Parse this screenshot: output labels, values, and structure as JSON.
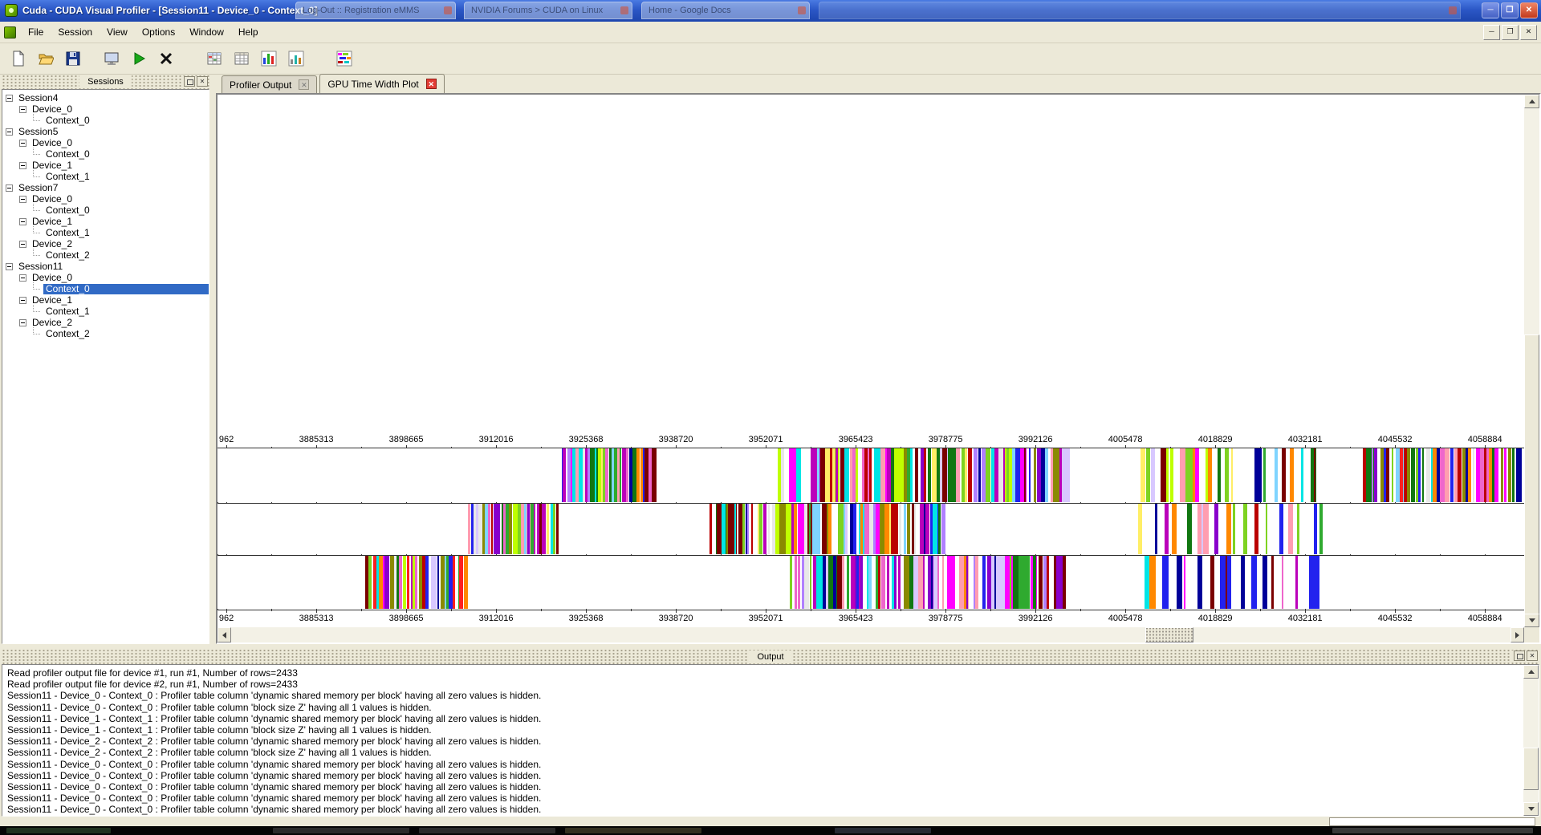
{
  "window": {
    "title": "Cuda - CUDA Visual Profiler - [Session11 - Device_0 - Context_0]",
    "controls": {
      "minimize": "─",
      "maximize": "❐",
      "close": "✕"
    },
    "ghost_windows": [
      "Log-Out :: Registration eMMS",
      "NVIDIA Forums > CUDA on Linux",
      "Home - Google Docs",
      ""
    ]
  },
  "menu": {
    "items": [
      "File",
      "Session",
      "View",
      "Options",
      "Window",
      "Help"
    ]
  },
  "mdi_controls": {
    "minimize": "─",
    "restore": "❐",
    "close": "✕"
  },
  "toolbar": {
    "icons": [
      "new-session-icon",
      "open-session-icon",
      "save-session-icon",
      "profiler-output-icon",
      "start-profiling-icon",
      "stop-icon",
      "profiler-table-icon",
      "summary-table-icon",
      "gpu-time-height-plot-icon",
      "gpu-time-summary-plot-icon",
      "gpu-time-width-plot-icon"
    ]
  },
  "sessions_panel": {
    "title": "Sessions",
    "tree": [
      {
        "label": "Session4",
        "level": 0
      },
      {
        "label": "Device_0",
        "level": 1
      },
      {
        "label": "Context_0",
        "level": 2,
        "leaf": true
      },
      {
        "label": "Session5",
        "level": 0
      },
      {
        "label": "Device_0",
        "level": 1
      },
      {
        "label": "Context_0",
        "level": 2,
        "leaf": true
      },
      {
        "label": "Device_1",
        "level": 1
      },
      {
        "label": "Context_1",
        "level": 2,
        "leaf": true
      },
      {
        "label": "Session7",
        "level": 0
      },
      {
        "label": "Device_0",
        "level": 1
      },
      {
        "label": "Context_0",
        "level": 2,
        "leaf": true
      },
      {
        "label": "Device_1",
        "level": 1
      },
      {
        "label": "Context_1",
        "level": 2,
        "leaf": true
      },
      {
        "label": "Device_2",
        "level": 1
      },
      {
        "label": "Context_2",
        "level": 2,
        "leaf": true
      },
      {
        "label": "Session11",
        "level": 0
      },
      {
        "label": "Device_0",
        "level": 1
      },
      {
        "label": "Context_0",
        "level": 2,
        "leaf": true,
        "selected": true
      },
      {
        "label": "Device_1",
        "level": 1
      },
      {
        "label": "Context_1",
        "level": 2,
        "leaf": true
      },
      {
        "label": "Device_2",
        "level": 1
      },
      {
        "label": "Context_2",
        "level": 2,
        "leaf": true
      }
    ]
  },
  "tabs": [
    {
      "label": "Profiler Output",
      "active": false
    },
    {
      "label": "GPU Time Width Plot",
      "active": true
    }
  ],
  "chart_data": {
    "type": "timeline",
    "title": "GPU Time Width Plot",
    "x_tick_labels": [
      "962",
      "3885313",
      "3898665",
      "3912016",
      "3925368",
      "3938720",
      "3952071",
      "3965423",
      "3978775",
      "3992126",
      "4005478",
      "4018829",
      "4032181",
      "4045532",
      "4058884"
    ],
    "x_axis": {
      "first_tick_fraction": 0.0068,
      "tick_step_fraction": 0.0688,
      "note": "GPU time axis; identical tick labels drawn above and below the lane stack"
    },
    "lanes": [
      {
        "name": "context-row-1",
        "clusters": [
          {
            "start": 0.262,
            "end": 0.331,
            "count": 30
          },
          {
            "start": 0.425,
            "end": 0.445,
            "count": 4
          },
          {
            "start": 0.452,
            "end": 0.56,
            "count": 36
          },
          {
            "start": 0.565,
            "end": 0.648,
            "count": 26
          },
          {
            "start": 0.703,
            "end": 0.778,
            "count": 15
          },
          {
            "start": 0.79,
            "end": 0.845,
            "count": 8
          },
          {
            "start": 0.876,
            "end": 0.995,
            "count": 40
          }
        ]
      },
      {
        "name": "context-row-2",
        "clusters": [
          {
            "start": 0.19,
            "end": 0.26,
            "count": 30
          },
          {
            "start": 0.376,
            "end": 0.47,
            "count": 32
          },
          {
            "start": 0.474,
            "end": 0.556,
            "count": 28
          },
          {
            "start": 0.703,
            "end": 0.85,
            "count": 18
          }
        ]
      },
      {
        "name": "context-row-3",
        "clusters": [
          {
            "start": 0.112,
            "end": 0.19,
            "count": 30
          },
          {
            "start": 0.436,
            "end": 0.56,
            "count": 40
          },
          {
            "start": 0.565,
            "end": 0.645,
            "count": 22
          },
          {
            "start": 0.703,
            "end": 0.838,
            "count": 16
          }
        ]
      }
    ],
    "palette": [
      "#ff00ff",
      "#ee66cc",
      "#bb00bb",
      "#8800cc",
      "#b080ff",
      "#d8c8ff",
      "#ff9db0",
      "#ff2020",
      "#bb0000",
      "#7a0000",
      "#ff8800",
      "#ffee66",
      "#bfff00",
      "#7ed321",
      "#2faa2f",
      "#117711",
      "#8a8a00",
      "#00e5e5",
      "#7fd4ff",
      "#2222ee",
      "#000099",
      "#e8e8e8"
    ]
  },
  "output_panel": {
    "title": "Output",
    "lines": [
      "Read profiler output file for device #1, run #1, Number of rows=2433",
      "Read profiler output file for device #2, run #1, Number of rows=2433",
      "Session11 - Device_0 - Context_0 : Profiler table column 'dynamic shared memory per block' having all zero values is hidden.",
      "Session11 - Device_0 - Context_0 : Profiler table column 'block size Z' having all 1 values is hidden.",
      "Session11 - Device_1 - Context_1 : Profiler table column 'dynamic shared memory per block' having all zero values is hidden.",
      "Session11 - Device_1 - Context_1 : Profiler table column 'block size Z' having all 1 values is hidden.",
      "Session11 - Device_2 - Context_2 : Profiler table column 'dynamic shared memory per block' having all zero values is hidden.",
      "Session11 - Device_2 - Context_2 : Profiler table column 'block size Z' having all 1 values is hidden.",
      "Session11 - Device_0 - Context_0 : Profiler table column 'dynamic shared memory per block' having all zero values is hidden.",
      "Session11 - Device_0 - Context_0 : Profiler table column 'dynamic shared memory per block' having all zero values is hidden.",
      "Session11 - Device_0 - Context_0 : Profiler table column 'dynamic shared memory per block' having all zero values is hidden.",
      "Session11 - Device_0 - Context_0 : Profiler table column 'dynamic shared memory per block' having all zero values is hidden.",
      "Session11 - Device_0 - Context_0 : Profiler table column 'dynamic shared memory per block' having all zero values is hidden."
    ]
  }
}
